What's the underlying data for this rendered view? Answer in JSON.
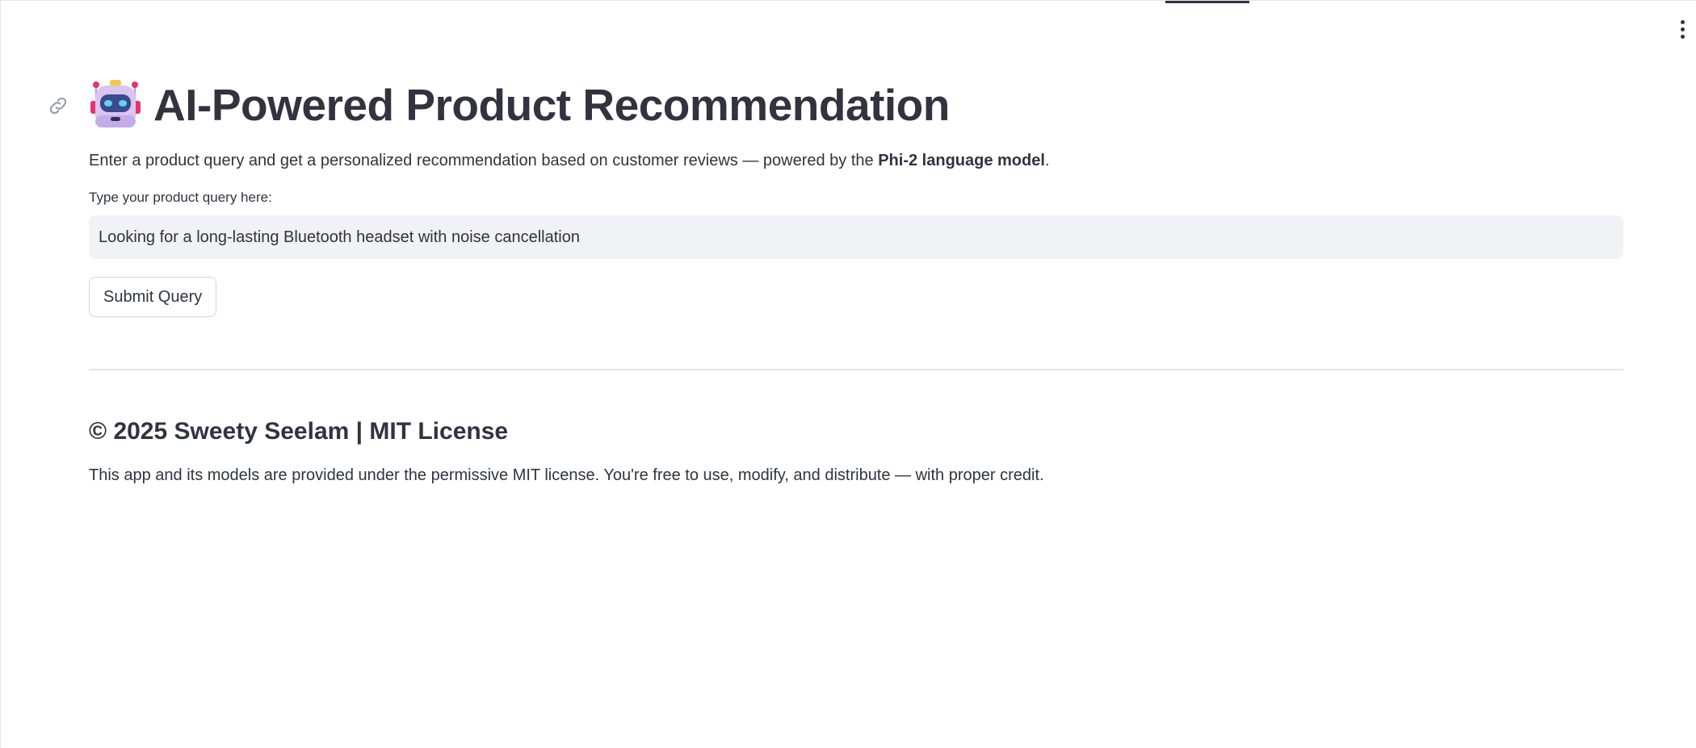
{
  "header": {
    "menu_icon": "vertical-ellipsis-icon"
  },
  "main": {
    "title_icon": "robot-face-icon",
    "title": "AI-Powered Product Recommendation",
    "link_icon": "link-icon",
    "intro": {
      "prefix": "Enter a product query and get a personalized recommendation based on customer reviews — powered by the ",
      "emphasis": "Phi-2 language model",
      "suffix": "."
    },
    "query": {
      "label": "Type your product query here:",
      "value": "Looking for a long-lasting Bluetooth headset with noise cancellation"
    },
    "submit_label": "Submit Query"
  },
  "footer": {
    "heading": "© 2025 Sweety Seelam | MIT License",
    "text": "This app and its models are provided under the permissive MIT license. You're free to use, modify, and distribute — with proper credit."
  },
  "colors": {
    "text": "#31333f",
    "input_bg": "#f0f2f6",
    "divider": "#e3e4e8",
    "robot_head": "#d9c5f0",
    "robot_antenna": "#e8336c"
  }
}
